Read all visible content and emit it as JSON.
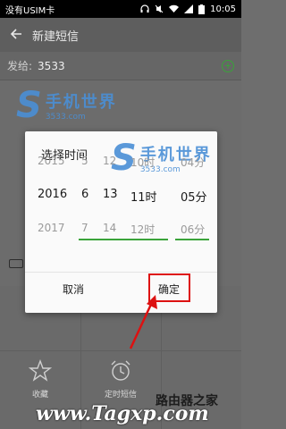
{
  "status_bar": {
    "carrier": "没有USIM卡",
    "time": "10:05"
  },
  "app_bar": {
    "title": "新建短信"
  },
  "recipient": {
    "label": "发给:",
    "value": "3533"
  },
  "dialog": {
    "title": "选择时间",
    "columns": [
      {
        "prev": "2015",
        "selected": "2016",
        "next": "2017"
      },
      {
        "prev": "5",
        "selected": "6",
        "next": "7"
      },
      {
        "prev": "12",
        "selected": "13",
        "next": "14"
      },
      {
        "prev": "10时",
        "selected": "11时",
        "next": "12时"
      },
      {
        "prev": "04分",
        "selected": "05分",
        "next": "06分"
      }
    ],
    "cancel_label": "取消",
    "ok_label": "确定"
  },
  "attachments": [
    {
      "label": "收藏",
      "icon": "star-icon"
    },
    {
      "label": "定时短信",
      "icon": "alarm-clock-icon"
    }
  ],
  "watermark": {
    "cn": "手机世界",
    "en": "3533.com"
  },
  "banner": {
    "en": "www.Tagxp.com",
    "cn": "路由器之家"
  },
  "colors": {
    "accent": "#3aa33a",
    "highlight": "#dd1111",
    "watermark": "#4a8fd6"
  }
}
